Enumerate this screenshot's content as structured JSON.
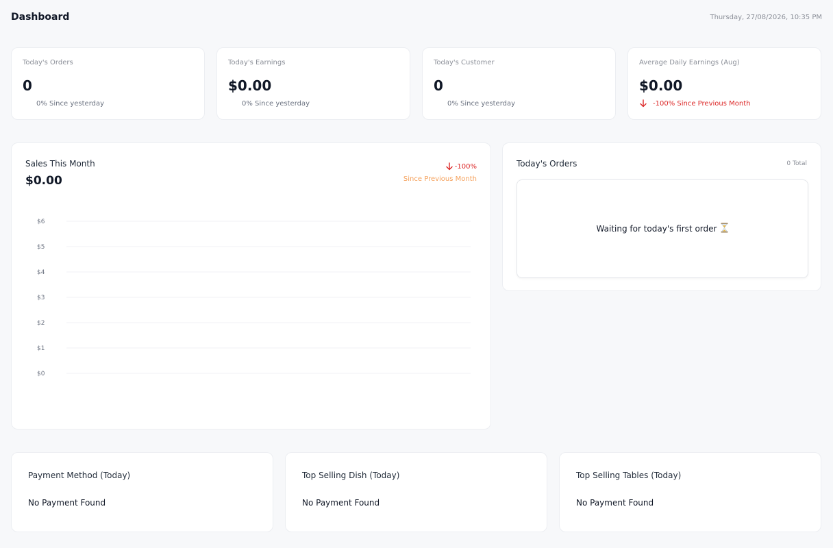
{
  "header": {
    "title": "Dashboard",
    "datetime": "Thursday, 27/08/2026, 10:35 PM"
  },
  "stats": [
    {
      "label": "Today's Orders",
      "value": "0",
      "trend": "0% Since yesterday",
      "direction": "neutral"
    },
    {
      "label": "Today's Earnings",
      "value": "$0.00",
      "trend": "0% Since yesterday",
      "direction": "neutral"
    },
    {
      "label": "Today's Customer",
      "value": "0",
      "trend": "0% Since yesterday",
      "direction": "neutral"
    },
    {
      "label": "Average Daily Earnings (Aug)",
      "value": "$0.00",
      "trend": "-100% Since Previous Month",
      "direction": "down"
    }
  ],
  "sales": {
    "title": "Sales This Month",
    "amount": "$0.00",
    "change_pct": "-100%",
    "change_since": "Since Previous Month"
  },
  "chart_data": {
    "type": "line",
    "title": "",
    "xlabel": "",
    "ylabel": "",
    "ylim": [
      0,
      6
    ],
    "y_ticks": [
      "$0",
      "$1",
      "$2",
      "$3",
      "$4",
      "$5",
      "$6"
    ],
    "grid": true,
    "series": []
  },
  "orders": {
    "title": "Today's Orders",
    "total": "0 Total",
    "empty_message": "Waiting for today's first order",
    "empty_icon": "hourglass-icon"
  },
  "bottom_cards": [
    {
      "title": "Payment Method (Today)",
      "empty": "No Payment Found"
    },
    {
      "title": "Top Selling Dish (Today)",
      "empty": "No Payment Found"
    },
    {
      "title": "Top Selling Tables (Today)",
      "empty": "No Payment Found"
    }
  ],
  "colors": {
    "background": "#f7f8fa",
    "card": "#ffffff",
    "negative": "#dc2626",
    "accent_orange": "#f5a15c",
    "muted": "#8b8f98"
  }
}
